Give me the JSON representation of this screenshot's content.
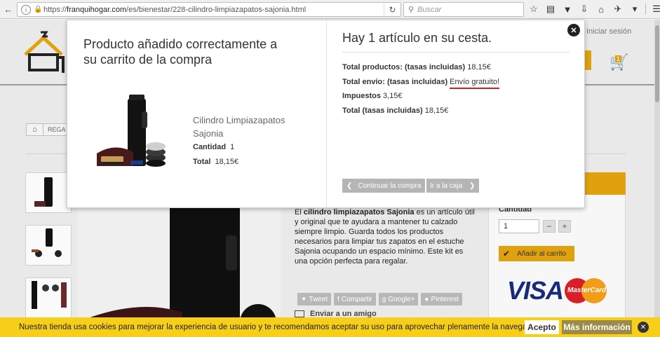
{
  "browser": {
    "url_prefix": "https://",
    "url_domain": "franquihogar.com",
    "url_path": "/es/bienestar/228-cilindro-limpiazapatos-sajonia.html",
    "search_placeholder": "Buscar"
  },
  "header": {
    "login_label": "Iniciar sesión",
    "cart_count": "1"
  },
  "breadcrumb": {
    "crumb": "REGA"
  },
  "product_page": {
    "description_bold": "cilindro limpiazapatos Sajonia",
    "description_pre": "El ",
    "description_post": " es un artículo útil y original que te ayudara a mantener tu calzado siempre limpio. Guarda todos los productos necesarios para limpiar tus zapatos en el estuche Sajonia ocupando un espacio mínimo. Este kit es una opción perfecta para regalar.",
    "share": [
      "Tweet",
      "Compartir",
      "Google+",
      "Pinterest"
    ],
    "email_friend": "Enviar a un amigo",
    "quantity_label": "Cantidad",
    "quantity_value": "1",
    "add_to_cart": "Añadir al carrito",
    "card_visa": "VISA",
    "card_mastercard": "MasterCard"
  },
  "modal": {
    "title": "Producto añadido correctamente a su carrito de la compra",
    "product_name": "Cilindro Limpiazapatos Sajonia",
    "quantity_label": "Cantidad",
    "quantity_value": "1",
    "total_label": "Total",
    "total_value": "18,15€",
    "cart_heading": "Hay 1 artículo en su cesta.",
    "products_total_label": "Total productos: (tasas incluidas)",
    "products_total_value": "18,15€",
    "shipping_label": "Total envío: (tasas incluidas)",
    "shipping_value": "Envío gratuito!",
    "tax_label": "Impuestos",
    "tax_value": "3,15€",
    "grand_total_label": "Total (tasas incluidas)",
    "grand_total_value": "18,15€",
    "continue_label": "Continuar la compra",
    "checkout_label": "Ir a la caja"
  },
  "cookie_bar": {
    "text": "Nuestra tienda usa cookies para mejorar la experiencia de usuario y te recomendamos aceptar su uso para aprovechar plenamente la navegación.",
    "accept": "Acepto",
    "more_info": "Más información"
  },
  "colors": {
    "accent": "#e0a10f",
    "cookie_bg": "#f7cf18",
    "free_shipping_underline": "#d81e27"
  }
}
